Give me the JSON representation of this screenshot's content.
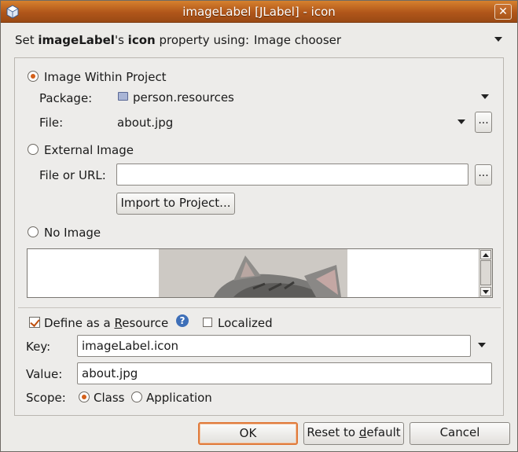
{
  "window": {
    "title": "imageLabel [JLabel] - icon",
    "close_glyph": "✕"
  },
  "property_line": {
    "prefix": "Set ",
    "component": "imageLabel",
    "mid": "'s ",
    "property": "icon",
    "suffix": " property using:",
    "editor": "Image chooser"
  },
  "image_source": {
    "within_project_label": "Image Within Project",
    "within_project_selected": true,
    "package_label": "Package:",
    "package_value": "person.resources",
    "file_label": "File:",
    "file_value": "about.jpg",
    "browse_label": "...",
    "external_label": "External Image",
    "external_selected": false,
    "file_or_url_label": "File or URL:",
    "file_or_url_value": "",
    "import_button": "Import to Project...",
    "no_image_label": "No Image",
    "no_image_selected": false
  },
  "preview": {
    "scroll_position": 0.05
  },
  "resource": {
    "define_label_pre": "Define as a ",
    "define_label_mnemonic": "R",
    "define_label_post": "esource",
    "define_checked": true,
    "help_icon": "?",
    "localized_label": "Localized",
    "localized_checked": false,
    "key_label": "Key:",
    "key_value": "imageLabel.icon",
    "value_label": "Value:",
    "value_value": "about.jpg",
    "scope_label": "Scope:",
    "scope_class": "Class",
    "scope_application": "Application",
    "scope_selected": "Class"
  },
  "buttons": {
    "ok": "OK",
    "reset_pre": "Reset to ",
    "reset_mnemonic": "d",
    "reset_post": "efault",
    "cancel": "Cancel"
  },
  "colors": {
    "title_bar": "#c06320",
    "accent": "#d4601a",
    "help_icon": "#3e6fb8"
  }
}
